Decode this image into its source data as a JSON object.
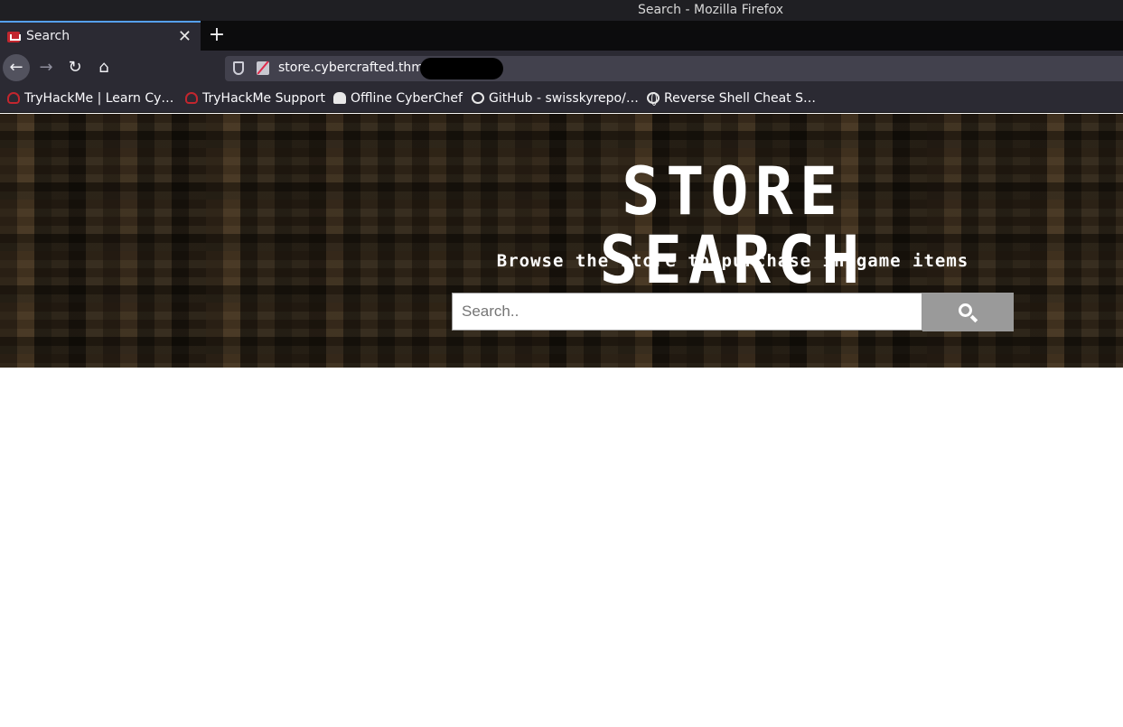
{
  "window": {
    "title": "Search - Mozilla Firefox"
  },
  "tabs": [
    {
      "label": "Search",
      "close": "✕",
      "favicon": "tryhackme-icon"
    }
  ],
  "new_tab": "+",
  "nav": {
    "back": "←",
    "forward": "→",
    "reload": "↻",
    "home": "⌂",
    "url": "store.cybercrafted.thm"
  },
  "bookmarks": [
    {
      "label": "TryHackMe | Learn Cy…",
      "icon": "cloud-icon"
    },
    {
      "label": "TryHackMe Support",
      "icon": "cloud-icon"
    },
    {
      "label": "Offline CyberChef",
      "icon": "chef-hat-icon"
    },
    {
      "label": "GitHub - swisskyrepo/…",
      "icon": "github-icon"
    },
    {
      "label": "Reverse Shell Cheat S…",
      "icon": "globe-icon"
    }
  ],
  "page": {
    "title": "STORE SEARCH",
    "subtitle": "Browse the store to purchase in-game items",
    "search": {
      "placeholder": "Search..",
      "value": ""
    },
    "search_button_icon": "search-icon"
  }
}
